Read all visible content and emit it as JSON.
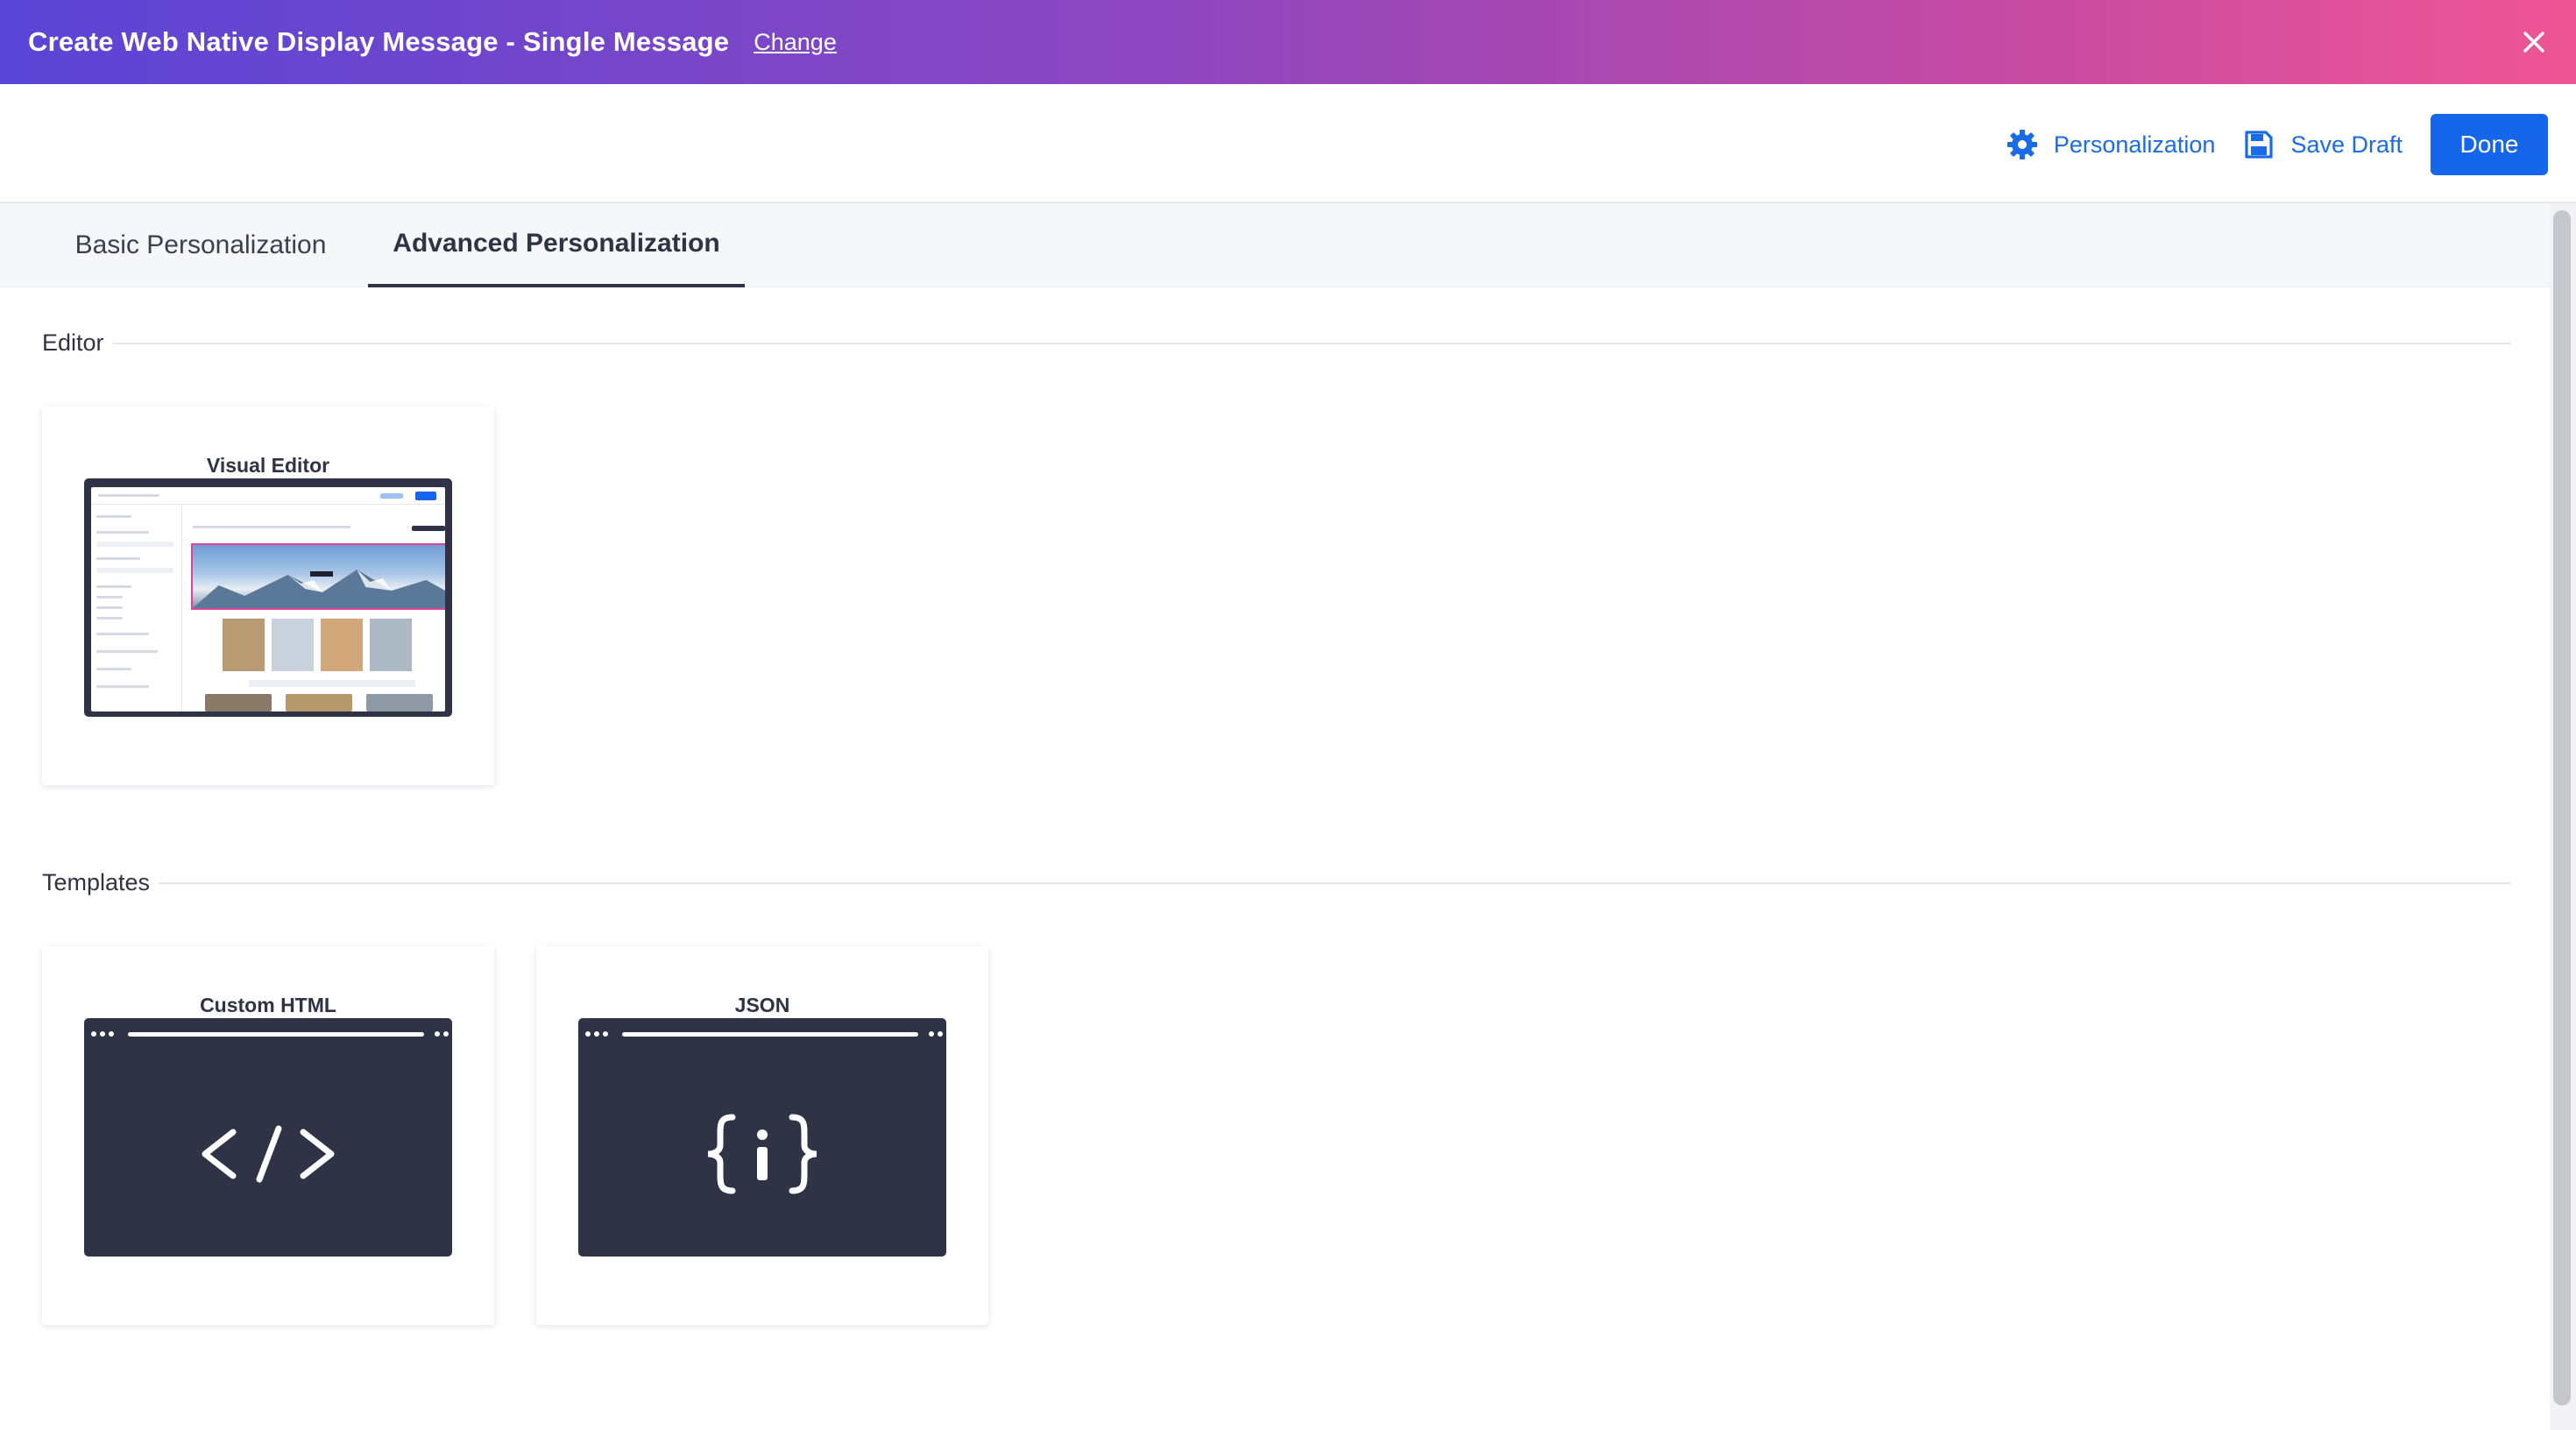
{
  "header": {
    "title": "Create Web Native Display Message - Single Message",
    "change_label": "Change"
  },
  "toolbar": {
    "personalization_label": "Personalization",
    "save_draft_label": "Save Draft",
    "done_label": "Done"
  },
  "tabs": [
    {
      "label": "Basic Personalization",
      "active": false
    },
    {
      "label": "Advanced Personalization",
      "active": true
    }
  ],
  "sections": {
    "editor": {
      "label": "Editor",
      "cards": [
        {
          "title": "Visual Editor"
        }
      ]
    },
    "templates": {
      "label": "Templates",
      "cards": [
        {
          "title": "Custom HTML"
        },
        {
          "title": "JSON"
        }
      ]
    }
  },
  "colors": {
    "gradient_start": "#5a45d6",
    "gradient_end": "#ef5594",
    "accent": "#1666ec",
    "thumb_bg": "#2f3346"
  },
  "icons": {
    "close": "close-icon",
    "personalization": "gear-icon",
    "save_draft": "floppy-disk-icon",
    "custom_html": "code-brackets-icon",
    "json": "curly-braces-icon"
  }
}
